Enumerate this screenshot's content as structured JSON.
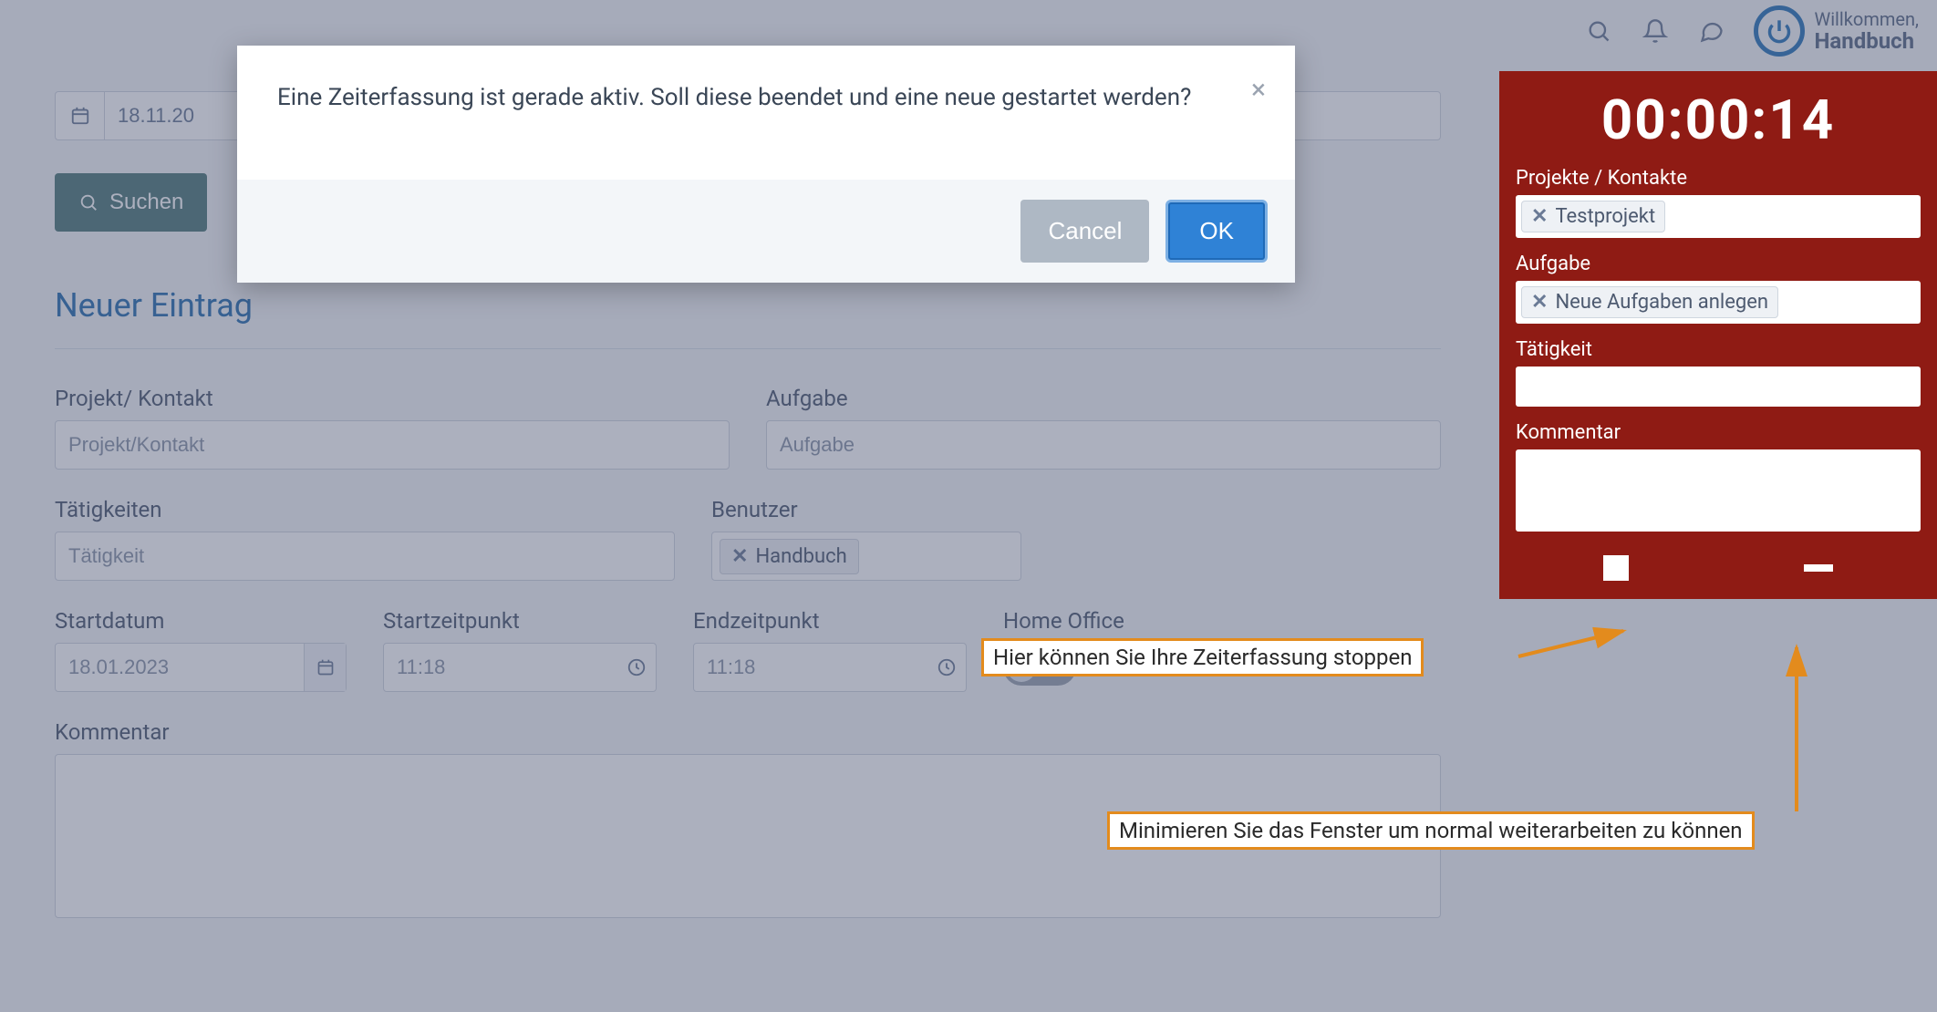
{
  "header": {
    "welcome_label": "Willkommen,",
    "user_name": "Handbuch"
  },
  "search": {
    "date": "18.11.20",
    "button": "Suchen"
  },
  "section_title": "Neuer Eintrag",
  "form": {
    "project_label": "Projekt/ Kontakt",
    "project_placeholder": "Projekt/Kontakt",
    "task_label": "Aufgabe",
    "task_placeholder": "Aufgabe",
    "activities_label": "Tätigkeiten",
    "activities_placeholder": "Tätigkeit",
    "user_label": "Benutzer",
    "user_tag": "Handbuch",
    "startdate_label": "Startdatum",
    "startdate_value": "18.01.2023",
    "starttime_label": "Startzeitpunkt",
    "starttime_value": "11:18",
    "endtime_label": "Endzeitpunkt",
    "endtime_value": "11:18",
    "homeoffice_label": "Home Office",
    "comment_label": "Kommentar"
  },
  "modal": {
    "message": "Eine Zeiterfassung ist gerade aktiv. Soll diese beendet und eine neue gestartet werden?",
    "cancel": "Cancel",
    "ok": "OK"
  },
  "timer": {
    "time": "00:00:14",
    "projects_label": "Projekte / Kontakte",
    "project_tag": "Testprojekt",
    "task_label": "Aufgabe",
    "task_tag": "Neue Aufgaben anlegen",
    "activity_label": "Tätigkeit",
    "comment_label": "Kommentar"
  },
  "callouts": {
    "stop": "Hier können Sie Ihre Zeiterfassung stoppen",
    "minimize": "Minimieren Sie das Fenster um normal weiterarbeiten zu können"
  }
}
